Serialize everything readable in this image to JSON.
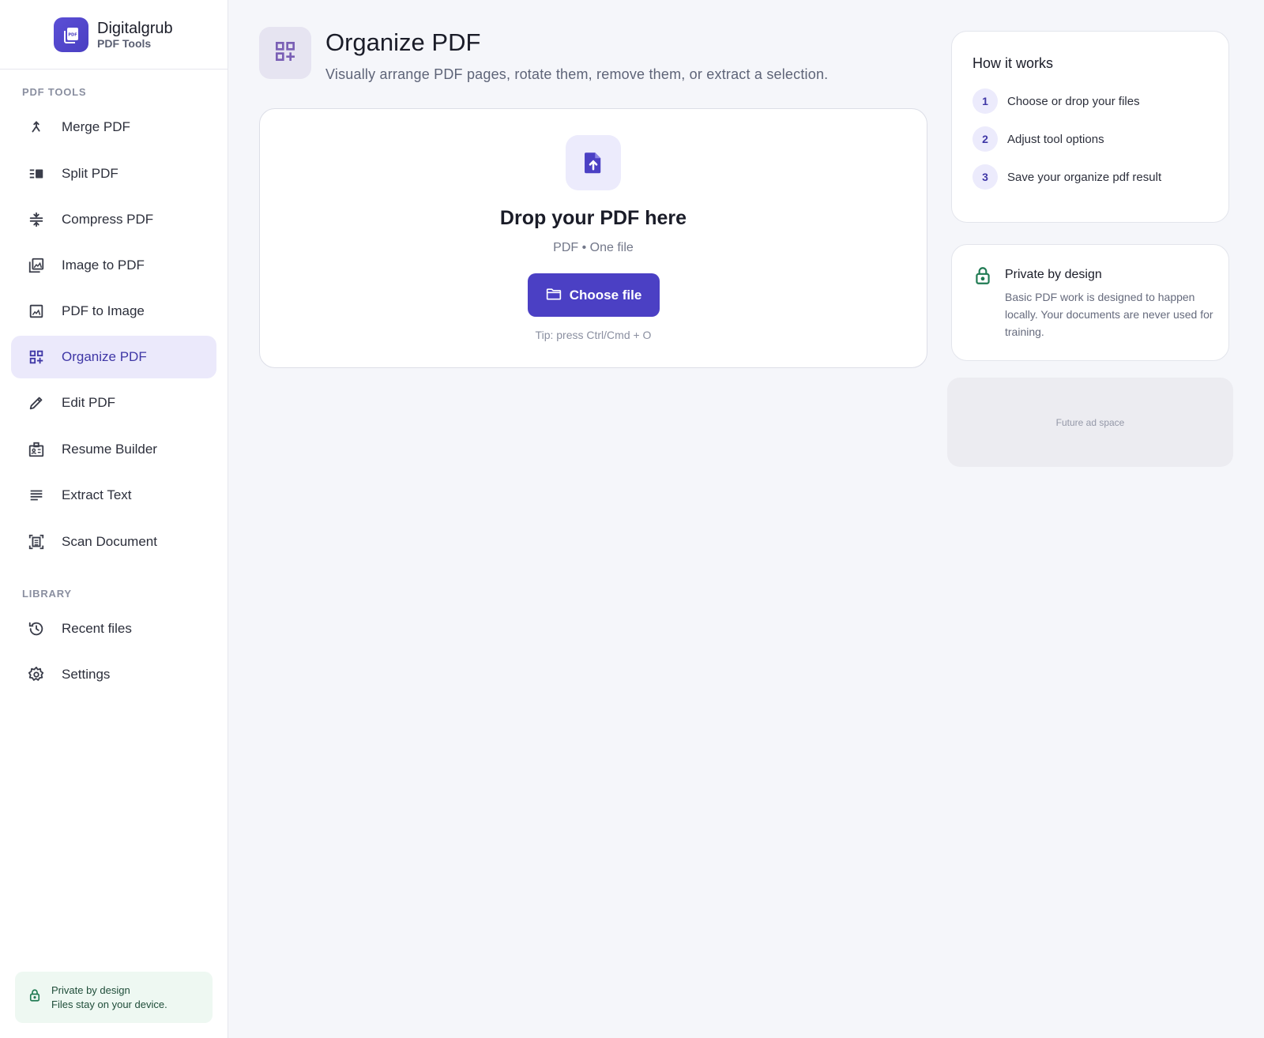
{
  "brand": {
    "name": "Digitalgrub",
    "subtitle": "PDF Tools",
    "logo_text": "PDF"
  },
  "sidebar": {
    "tools_section": "PDF TOOLS",
    "tools": [
      {
        "label": "Merge PDF",
        "icon": "merge-icon"
      },
      {
        "label": "Split PDF",
        "icon": "split-icon"
      },
      {
        "label": "Compress PDF",
        "icon": "compress-icon"
      },
      {
        "label": "Image to PDF",
        "icon": "images-icon"
      },
      {
        "label": "PDF to Image",
        "icon": "image-icon"
      },
      {
        "label": "Organize PDF",
        "icon": "grid-plus-icon",
        "active": true
      },
      {
        "label": "Edit PDF",
        "icon": "pencil-icon"
      },
      {
        "label": "Resume Builder",
        "icon": "badge-icon"
      },
      {
        "label": "Extract Text",
        "icon": "text-lines-icon"
      },
      {
        "label": "Scan Document",
        "icon": "scan-icon"
      }
    ],
    "library_section": "LIBRARY",
    "library": [
      {
        "label": "Recent files",
        "icon": "history-icon"
      },
      {
        "label": "Settings",
        "icon": "gear-icon"
      }
    ],
    "privacy": {
      "line1": "Private by design",
      "line2": "Files stay on your device."
    }
  },
  "header": {
    "title": "Organize PDF",
    "subtitle": "Visually arrange PDF pages, rotate them, remove them, or extract a selection."
  },
  "dropzone": {
    "title": "Drop your PDF here",
    "formats": "PDF • One file",
    "button_label": "Choose file",
    "tip": "Tip: press Ctrl/Cmd + O"
  },
  "how_it_works": {
    "title": "How it works",
    "steps": [
      {
        "num": "1",
        "text": "Choose or drop your files"
      },
      {
        "num": "2",
        "text": "Adjust tool options"
      },
      {
        "num": "3",
        "text": "Save your organize pdf result"
      }
    ]
  },
  "privacy_card": {
    "title": "Private by design",
    "text": "Basic PDF work is designed to happen locally. Your documents are never used for training."
  },
  "ad": {
    "label": "Future ad space"
  },
  "colors": {
    "accent": "#4b40c4",
    "accent_soft": "#ebe9fb",
    "privacy_green": "#1f7a52"
  }
}
